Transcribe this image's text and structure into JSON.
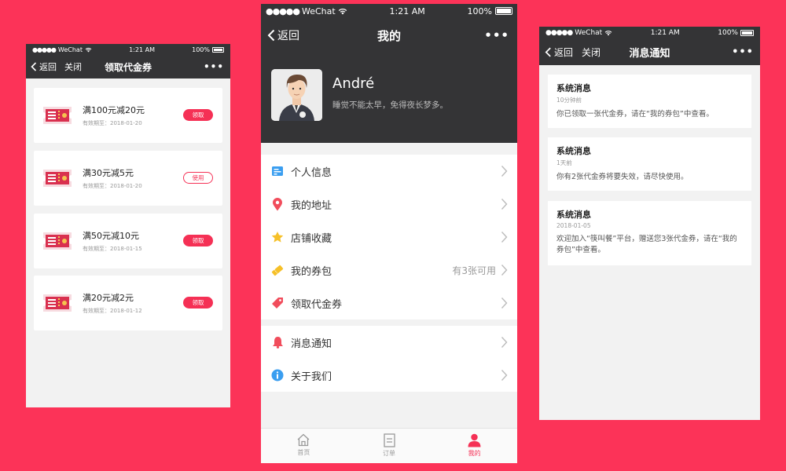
{
  "status_bar": {
    "dots": "●●●●●",
    "carrier": "WeChat",
    "time": "1:21 AM",
    "battery": "100%"
  },
  "colors": {
    "background": "#fc3358",
    "accent": "#f53055",
    "nav_bar": "#343436"
  },
  "screens": {
    "coupons": {
      "back": "返回",
      "close": "关闭",
      "title": "领取代金券",
      "more": "•••",
      "items": [
        {
          "title": "满100元减20元",
          "date": "有效期至：2018-01-20",
          "action": "领取",
          "action_style": "claim",
          "icon": "ticket-icon"
        },
        {
          "title": "满30元减5元",
          "date": "有效期至：2018-01-20",
          "action": "使用",
          "action_style": "use",
          "icon": "ticket-icon"
        },
        {
          "title": "满50元减10元",
          "date": "有效期至：2018-01-15",
          "action": "领取",
          "action_style": "claim",
          "icon": "ticket-icon"
        },
        {
          "title": "满20元减2元",
          "date": "有效期至：2018-01-12",
          "action": "领取",
          "action_style": "claim",
          "icon": "ticket-icon"
        }
      ]
    },
    "profile": {
      "back": "返回",
      "title": "我的",
      "more": "•••",
      "name": "André",
      "signature": "睡觉不能太早，免得夜长梦多。",
      "menu_group_1": [
        {
          "label": "个人信息",
          "icon": "profile-card-icon",
          "extra": ""
        },
        {
          "label": "我的地址",
          "icon": "location-pin-icon",
          "extra": ""
        },
        {
          "label": "店铺收藏",
          "icon": "star-icon",
          "extra": ""
        },
        {
          "label": "我的券包",
          "icon": "coupon-wallet-icon",
          "extra": "有3张可用"
        },
        {
          "label": "领取代金券",
          "icon": "tag-icon",
          "extra": ""
        }
      ],
      "menu_group_2": [
        {
          "label": "消息通知",
          "icon": "bell-icon",
          "extra": ""
        },
        {
          "label": "关于我们",
          "icon": "info-icon",
          "extra": ""
        }
      ],
      "tabs": [
        {
          "label": "首页",
          "icon": "home-icon",
          "active": false
        },
        {
          "label": "订单",
          "icon": "order-icon",
          "active": false
        },
        {
          "label": "我的",
          "icon": "user-icon",
          "active": true
        }
      ]
    },
    "messages": {
      "back": "返回",
      "close": "关闭",
      "title": "消息通知",
      "more": "•••",
      "items": [
        {
          "title": "系统消息",
          "time": "10分钟前",
          "body": "你已领取一张代金券，请在“我的券包”中查看。"
        },
        {
          "title": "系统消息",
          "time": "1天前",
          "body": "你有2张代金券将要失效，请尽快使用。"
        },
        {
          "title": "系统消息",
          "time": "2018-01-05",
          "body": "欢迎加入“筷叫餐”平台，赠送您3张代金券，请在“我的券包”中查看。"
        }
      ]
    }
  }
}
